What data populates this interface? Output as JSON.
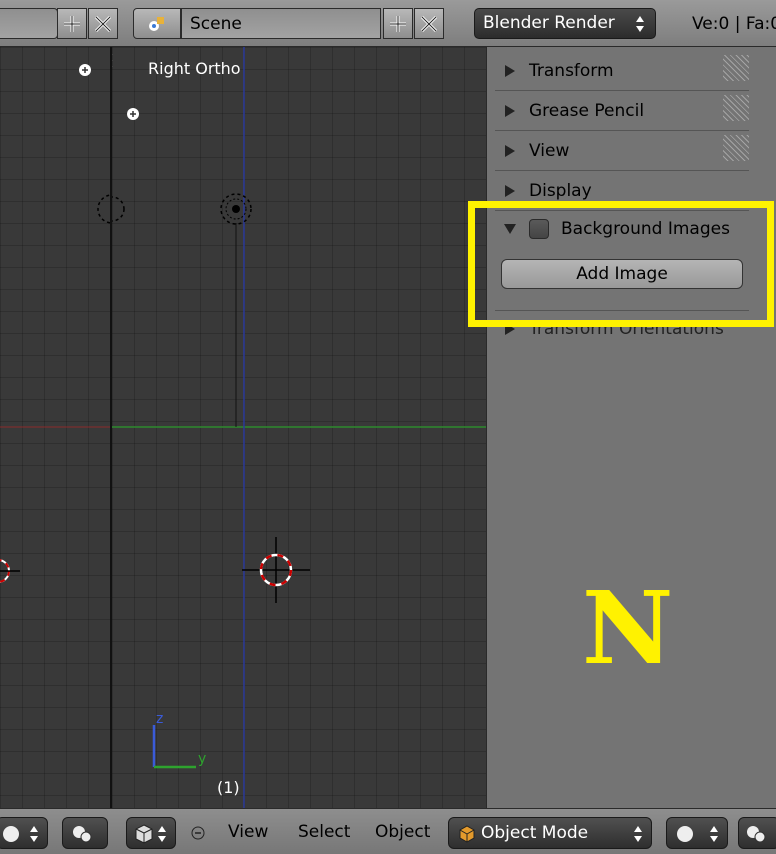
{
  "top_header": {
    "scene_label": "Scene",
    "render_engine": "Blender Render",
    "stats": "Ve:0 | Fa:0"
  },
  "viewport": {
    "title": "Right Ortho",
    "frame_label": "(1)",
    "axis_z_label": "z",
    "axis_y_label": "y"
  },
  "properties_panel": {
    "panels": [
      {
        "label": "Transform"
      },
      {
        "label": "Grease Pencil"
      },
      {
        "label": "View"
      },
      {
        "label": "Display"
      },
      {
        "label": "Background Images"
      },
      {
        "label": "Transform Orientations"
      }
    ],
    "add_image_label": "Add Image"
  },
  "annotation": {
    "hotkey": "N",
    "color": "#fff200"
  },
  "bottom_header": {
    "menu": [
      "View",
      "Select",
      "Object"
    ],
    "mode": "Object Mode"
  }
}
